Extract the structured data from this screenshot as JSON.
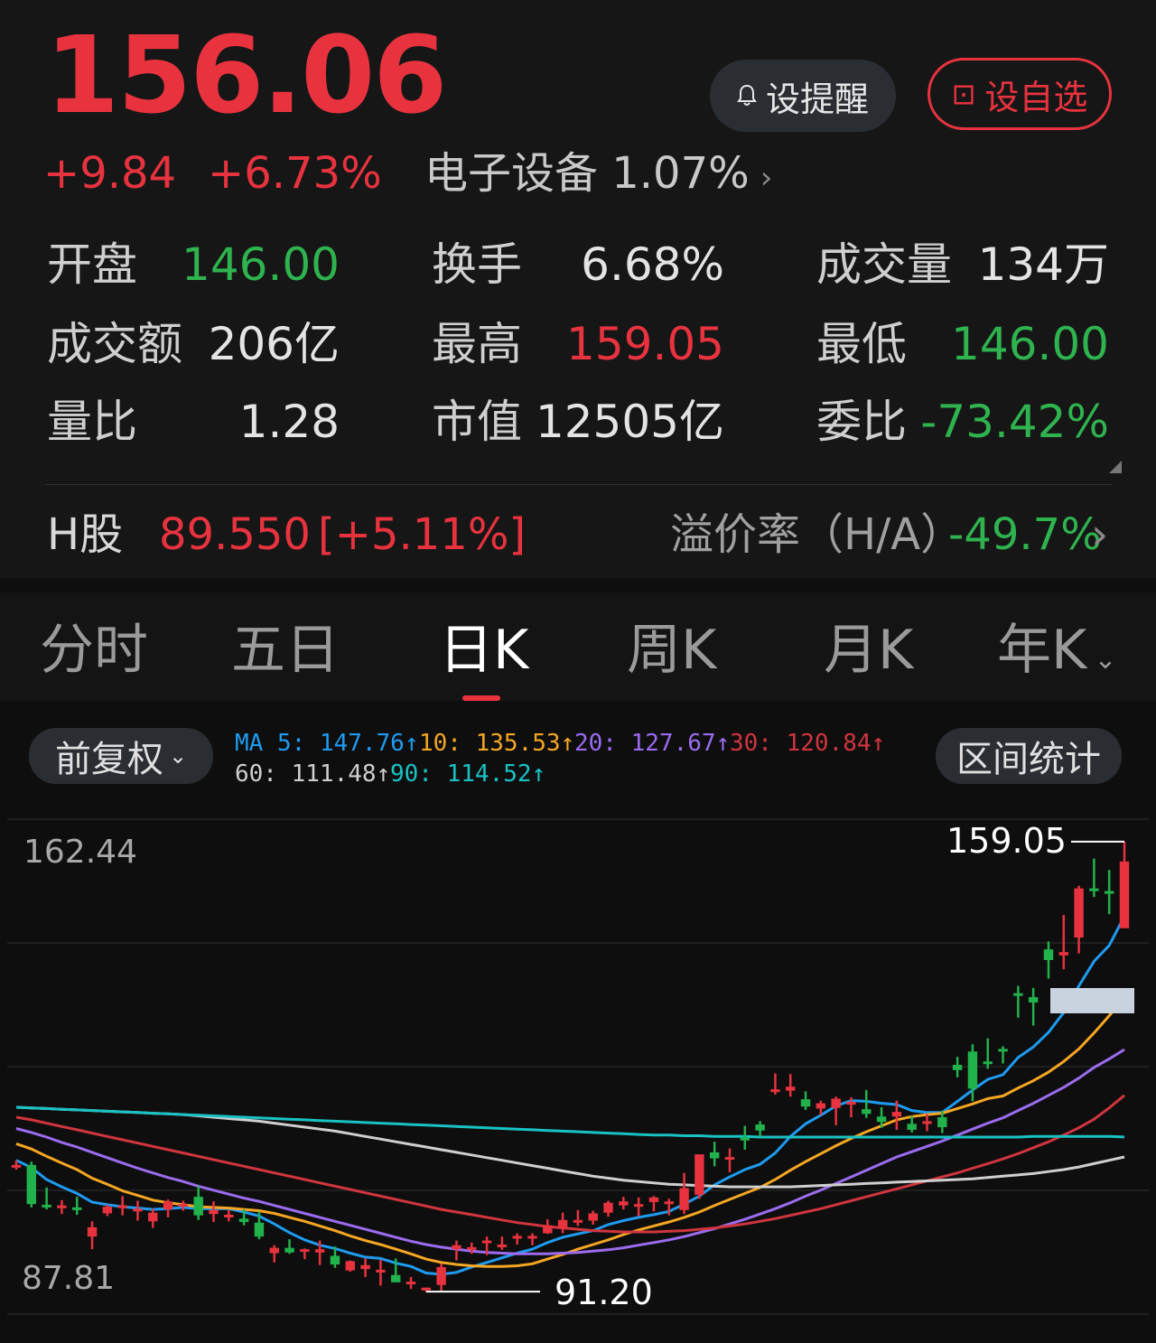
{
  "quote": {
    "price": "156.06",
    "change": "+9.84",
    "change_pct": "+6.73%",
    "sector": "电子设备 1.07%",
    "sector_arrow": "›"
  },
  "actions": {
    "alert_label": "设提醒",
    "watch_label": "设自选",
    "watch_icon": "⊡"
  },
  "stats": [
    {
      "label": "开盘",
      "value": "146.00",
      "color": "green"
    },
    {
      "label": "换手",
      "value": "6.68%",
      "color": "white"
    },
    {
      "label": "成交量",
      "value": "134万",
      "color": "white"
    },
    {
      "label": "成交额",
      "value": "206亿",
      "color": "white"
    },
    {
      "label": "最高",
      "value": "159.05",
      "color": "red"
    },
    {
      "label": "最低",
      "value": "146.00",
      "color": "green"
    },
    {
      "label": "量比",
      "value": "1.28",
      "color": "white"
    },
    {
      "label": "市值",
      "value": "12505亿",
      "color": "white"
    },
    {
      "label": "委比",
      "value": "-73.42%",
      "color": "green"
    }
  ],
  "h_share": {
    "label": "H股",
    "price": "89.550",
    "change": "[+5.11%]",
    "premium_label": "溢价率（H/A）",
    "premium_value": "-49.7%",
    "arrow": "›"
  },
  "tabs": [
    {
      "label": "分时",
      "active": false
    },
    {
      "label": "五日",
      "active": false
    },
    {
      "label": "日K",
      "active": true
    },
    {
      "label": "周K",
      "active": false
    },
    {
      "label": "月K",
      "active": false
    },
    {
      "label": "年K",
      "active": false
    }
  ],
  "tab_more_icon": "⌄",
  "chart_controls": {
    "adjust_label": "前复权",
    "adjust_icon": "⌄",
    "range_stats_label": "区间统计"
  },
  "ma_legend": [
    {
      "text": "MA 5: 147.76↑",
      "color": "#1e9bf0"
    },
    {
      "text": "10: 135.53↑",
      "color": "#f5a623"
    },
    {
      "text": "20: 127.67↑",
      "color": "#9b6cf0"
    },
    {
      "text": "30: 120.84↑",
      "color": "#d0353f"
    },
    {
      "text": "60: 111.48↑",
      "color": "#cfcfcf"
    },
    {
      "text": "90: 114.52↑",
      "color": "#19c2c4"
    }
  ],
  "chart_data": {
    "type": "candlestick",
    "y_axis_labels": [
      "162.44",
      "87.81"
    ],
    "ylim": [
      87.81,
      162.44
    ],
    "max_marker": "159.05",
    "min_marker": "91.20",
    "up_color": "#e8333f",
    "down_color": "#22b24c",
    "candles": [
      [
        110.2,
        111.0,
        109.6,
        110.3
      ],
      [
        110.3,
        110.8,
        103.9,
        104.4
      ],
      [
        104.3,
        106.9,
        103.6,
        104.1
      ],
      [
        104.0,
        105.0,
        102.9,
        104.2
      ],
      [
        103.9,
        105.5,
        102.8,
        103.6
      ],
      [
        99.5,
        101.8,
        97.6,
        100.9
      ],
      [
        103.0,
        104.3,
        102.6,
        104.0
      ],
      [
        103.8,
        105.6,
        102.7,
        104.2
      ],
      [
        103.4,
        104.9,
        101.9,
        103.7
      ],
      [
        101.8,
        103.7,
        100.8,
        103.1
      ],
      [
        103.6,
        105.1,
        102.4,
        104.8
      ],
      [
        104.1,
        104.9,
        103.4,
        104.4
      ],
      [
        105.5,
        107.1,
        102.0,
        102.7
      ],
      [
        102.9,
        104.8,
        101.7,
        103.5
      ],
      [
        102.5,
        103.5,
        101.8,
        102.8
      ],
      [
        102.2,
        103.6,
        101.2,
        101.7
      ],
      [
        101.6,
        103.3,
        99.1,
        99.5
      ],
      [
        97.0,
        98.2,
        95.6,
        97.8
      ],
      [
        97.8,
        99.1,
        96.9,
        97.1
      ],
      [
        97.3,
        97.7,
        96.1,
        97.6
      ],
      [
        97.1,
        98.9,
        95.2,
        97.6
      ],
      [
        96.6,
        98.0,
        94.8,
        95.3
      ],
      [
        94.4,
        95.9,
        94.2,
        95.8
      ],
      [
        94.6,
        96.2,
        93.4,
        95.2
      ],
      [
        94.2,
        96.0,
        92.1,
        94.5
      ],
      [
        93.7,
        96.2,
        93.4,
        92.6
      ],
      [
        92.3,
        93.4,
        91.6,
        92.7
      ],
      [
        91.5,
        91.8,
        91.2,
        91.8
      ],
      [
        92.2,
        95.4,
        91.2,
        94.9
      ],
      [
        97.6,
        98.9,
        95.9,
        98.2
      ],
      [
        97.6,
        98.6,
        96.9,
        97.9
      ],
      [
        98.6,
        99.5,
        96.7,
        98.9
      ],
      [
        98.0,
        99.5,
        97.5,
        98.3
      ],
      [
        99.2,
        100.0,
        98.3,
        99.6
      ],
      [
        99.4,
        100.0,
        98.2,
        99.6
      ],
      [
        100.0,
        102.1,
        99.9,
        101.2
      ],
      [
        100.8,
        103.1,
        100.0,
        102.0
      ],
      [
        101.6,
        103.5,
        101.1,
        102.0
      ],
      [
        101.9,
        103.4,
        101.3,
        103.0
      ],
      [
        103.1,
        104.9,
        102.5,
        104.6
      ],
      [
        104.2,
        105.5,
        103.6,
        104.8
      ],
      [
        104.1,
        105.4,
        102.6,
        104.4
      ],
      [
        104.7,
        105.6,
        103.3,
        105.4
      ],
      [
        104.8,
        105.2,
        102.7,
        104.8
      ],
      [
        103.5,
        109.1,
        102.9,
        106.8
      ],
      [
        105.8,
        109.1,
        105.2,
        111.9
      ],
      [
        112.2,
        113.8,
        110.1,
        111.3
      ],
      [
        111.2,
        112.8,
        109.2,
        111.5
      ],
      [
        114.4,
        116.2,
        112.6,
        114.3
      ],
      [
        116.4,
        116.9,
        114.6,
        115.5
      ],
      [
        121.4,
        124.1,
        120.9,
        121.7
      ],
      [
        121.5,
        124.0,
        120.6,
        122.1
      ],
      [
        120.2,
        121.4,
        118.6,
        119.1
      ],
      [
        118.8,
        120.0,
        117.8,
        119.6
      ],
      [
        118.9,
        120.6,
        116.3,
        120.3
      ],
      [
        119.5,
        120.5,
        117.5,
        119.8
      ],
      [
        118.7,
        121.6,
        117.4,
        118.0
      ],
      [
        117.6,
        119.0,
        115.9,
        116.8
      ],
      [
        117.6,
        120.0,
        115.6,
        118.3
      ],
      [
        116.5,
        117.7,
        115.2,
        115.6
      ],
      [
        116.8,
        118.0,
        115.4,
        116.9
      ],
      [
        117.5,
        118.5,
        115.1,
        116.0
      ],
      [
        125.4,
        126.6,
        123.5,
        124.6
      ],
      [
        127.4,
        128.5,
        119.9,
        121.8
      ],
      [
        125.9,
        129.4,
        124.8,
        125.6
      ],
      [
        127.8,
        128.2,
        125.6,
        127.5
      ],
      [
        136.2,
        137.3,
        132.5,
        135.9
      ],
      [
        135.6,
        137.0,
        131.3,
        134.8
      ],
      [
        142.8,
        144.0,
        138.4,
        141.2
      ],
      [
        141.9,
        148.0,
        139.8,
        142.4
      ],
      [
        144.6,
        152.4,
        142.2,
        152.0
      ],
      [
        152.0,
        156.5,
        150.7,
        151.8
      ],
      [
        151.6,
        154.8,
        148.1,
        151.4
      ],
      [
        146.0,
        159.05,
        146.0,
        156.06
      ]
    ],
    "ma": [
      {
        "name": "MA5",
        "color": "#1e9bf0",
        "values": [
          111.0,
          109.9,
          108.1,
          107.0,
          106.0,
          104.7,
          104.3,
          104.0,
          103.8,
          103.6,
          103.7,
          103.9,
          103.7,
          103.7,
          103.7,
          103.2,
          102.6,
          101.4,
          100.1,
          99.0,
          98.2,
          97.7,
          97.0,
          96.4,
          96.2,
          95.5,
          95.0,
          94.0,
          93.8,
          94.1,
          94.9,
          95.6,
          96.3,
          97.0,
          97.6,
          98.6,
          99.4,
          99.9,
          100.4,
          101.3,
          101.9,
          102.4,
          102.8,
          103.3,
          104.4,
          105.6,
          107.3,
          108.5,
          109.6,
          110.4,
          112.1,
          114.6,
          116.5,
          117.8,
          119.2,
          120.0,
          119.9,
          119.6,
          119.4,
          118.5,
          118.2,
          118.2,
          119.9,
          121.6,
          123.2,
          123.9,
          126.5,
          128.1,
          130.3,
          133.3,
          137.3,
          141.0,
          143.4,
          147.8
        ]
      },
      {
        "name": "MA10",
        "color": "#f5a623",
        "values": [
          113.5,
          112.7,
          111.6,
          110.6,
          109.6,
          108.3,
          107.4,
          106.4,
          105.7,
          105.0,
          104.6,
          104.3,
          104.0,
          103.9,
          103.8,
          103.6,
          103.4,
          103.0,
          102.4,
          101.8,
          101.1,
          100.4,
          99.6,
          98.9,
          98.3,
          97.6,
          96.9,
          96.1,
          95.6,
          95.3,
          95.1,
          95.0,
          95.0,
          95.1,
          95.4,
          96.1,
          96.8,
          97.6,
          98.3,
          99.0,
          99.8,
          100.5,
          101.1,
          101.7,
          102.4,
          103.2,
          104.2,
          105.1,
          106.0,
          106.9,
          108.1,
          109.5,
          110.8,
          112.0,
          113.2,
          114.3,
          115.3,
          116.2,
          117.1,
          117.6,
          117.9,
          118.1,
          118.8,
          119.5,
          120.3,
          120.7,
          121.9,
          123.0,
          124.3,
          125.9,
          127.8,
          130.2,
          132.8,
          135.5
        ]
      },
      {
        "name": "MA20",
        "color": "#9b6cf0",
        "values": [
          115.8,
          115.2,
          114.5,
          113.7,
          113.0,
          112.2,
          111.4,
          110.6,
          109.8,
          109.1,
          108.4,
          107.8,
          107.1,
          106.5,
          105.9,
          105.3,
          104.8,
          104.2,
          103.6,
          103.0,
          102.4,
          101.8,
          101.2,
          100.6,
          100.0,
          99.4,
          98.8,
          98.3,
          97.9,
          97.6,
          97.3,
          97.1,
          97.0,
          96.9,
          96.9,
          96.9,
          97.0,
          97.1,
          97.3,
          97.5,
          97.8,
          98.2,
          98.6,
          99.0,
          99.5,
          100.1,
          100.7,
          101.4,
          102.1,
          102.9,
          103.7,
          104.6,
          105.6,
          106.5,
          107.5,
          108.5,
          109.5,
          110.5,
          111.5,
          112.3,
          113.1,
          113.9,
          114.8,
          115.7,
          116.6,
          117.4,
          118.5,
          119.6,
          120.8,
          122.0,
          123.4,
          125.0,
          126.3,
          127.7
        ]
      },
      {
        "name": "MA30",
        "color": "#d0353f",
        "values": [
          117.5,
          117.1,
          116.6,
          116.1,
          115.6,
          115.1,
          114.6,
          114.1,
          113.6,
          113.1,
          112.6,
          112.1,
          111.6,
          111.1,
          110.6,
          110.1,
          109.6,
          109.1,
          108.6,
          108.1,
          107.6,
          107.1,
          106.6,
          106.1,
          105.6,
          105.1,
          104.6,
          104.1,
          103.6,
          103.2,
          102.8,
          102.4,
          102.0,
          101.6,
          101.3,
          101.0,
          100.8,
          100.6,
          100.4,
          100.3,
          100.2,
          100.2,
          100.2,
          100.3,
          100.4,
          100.6,
          100.8,
          101.1,
          101.4,
          101.8,
          102.2,
          102.7,
          103.2,
          103.7,
          104.3,
          104.9,
          105.5,
          106.1,
          106.7,
          107.3,
          107.9,
          108.5,
          109.1,
          109.8,
          110.5,
          111.2,
          112.0,
          112.9,
          113.8,
          114.8,
          115.9,
          117.2,
          118.9,
          120.8
        ]
      },
      {
        "name": "MA60",
        "color": "#cfcfcf",
        "values": [
          119.0,
          118.9,
          118.8,
          118.7,
          118.6,
          118.5,
          118.4,
          118.3,
          118.2,
          118.1,
          118.0,
          117.9,
          117.7,
          117.5,
          117.3,
          117.1,
          116.9,
          116.6,
          116.3,
          116.0,
          115.7,
          115.4,
          115.0,
          114.6,
          114.2,
          113.8,
          113.4,
          113.0,
          112.6,
          112.2,
          111.8,
          111.4,
          111.0,
          110.6,
          110.2,
          109.8,
          109.4,
          109.0,
          108.6,
          108.3,
          108.0,
          107.8,
          107.6,
          107.4,
          107.3,
          107.2,
          107.1,
          107.0,
          107.0,
          107.0,
          107.0,
          107.0,
          107.1,
          107.2,
          107.3,
          107.4,
          107.5,
          107.6,
          107.7,
          107.8,
          107.9,
          108.0,
          108.1,
          108.2,
          108.4,
          108.6,
          108.8,
          109.0,
          109.3,
          109.6,
          110.0,
          110.5,
          111.0,
          111.5
        ]
      },
      {
        "name": "MA90",
        "color": "#19c2c4",
        "values": [
          119.0,
          118.9,
          118.8,
          118.7,
          118.6,
          118.5,
          118.4,
          118.3,
          118.2,
          118.1,
          118.0,
          117.9,
          117.8,
          117.7,
          117.6,
          117.5,
          117.4,
          117.3,
          117.2,
          117.1,
          117.0,
          116.9,
          116.8,
          116.7,
          116.6,
          116.5,
          116.4,
          116.3,
          116.2,
          116.1,
          116.0,
          115.9,
          115.8,
          115.7,
          115.6,
          115.5,
          115.4,
          115.3,
          115.2,
          115.1,
          115.0,
          114.9,
          114.8,
          114.8,
          114.7,
          114.7,
          114.6,
          114.6,
          114.6,
          114.5,
          114.5,
          114.5,
          114.5,
          114.5,
          114.5,
          114.5,
          114.5,
          114.5,
          114.5,
          114.5,
          114.5,
          114.5,
          114.5,
          114.5,
          114.5,
          114.5,
          114.5,
          114.6,
          114.6,
          114.6,
          114.6,
          114.6,
          114.6,
          114.52
        ]
      }
    ]
  }
}
